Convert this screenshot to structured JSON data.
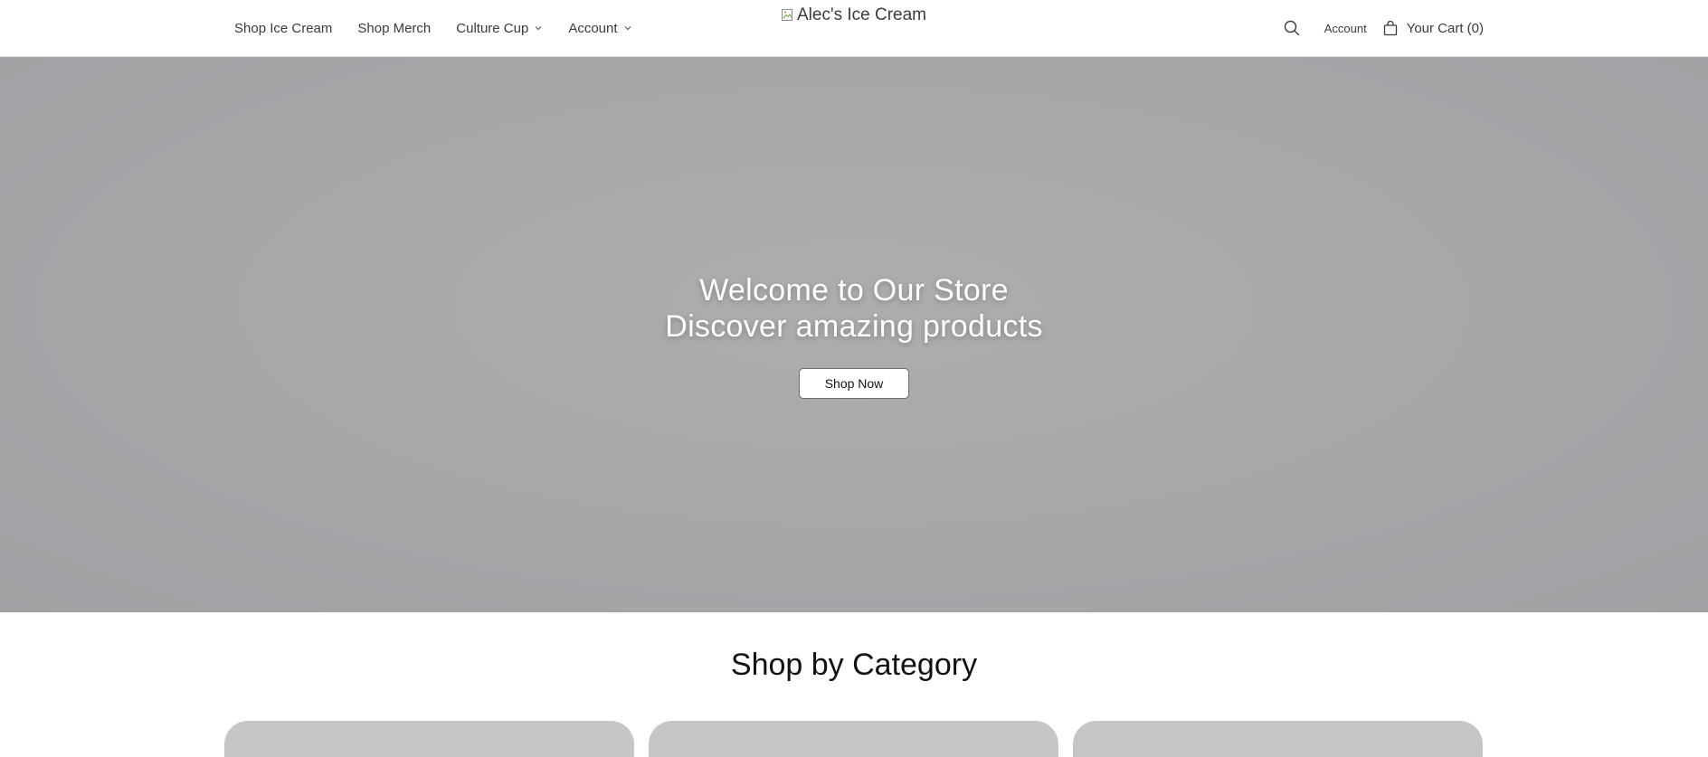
{
  "header": {
    "nav": [
      {
        "label": "Shop Ice Cream",
        "has_dropdown": false
      },
      {
        "label": "Shop Merch",
        "has_dropdown": false
      },
      {
        "label": "Culture Cup",
        "has_dropdown": true
      },
      {
        "label": "Account",
        "has_dropdown": true
      }
    ],
    "logo_alt": "Alec's Ice Cream",
    "account_label": "Account",
    "cart_label": "Your Cart (0)"
  },
  "hero": {
    "title_line1": "Welcome to Our Store",
    "title_line2": "Discover amazing products",
    "button_label": "Shop Now"
  },
  "category": {
    "title": "Shop by Category",
    "cards": 3
  },
  "icons": {
    "search": "search-icon",
    "cart": "shopping-bag-icon",
    "chevron": "chevron-down-icon",
    "broken_image": "broken-image-icon"
  },
  "colors": {
    "hero_bg": "#a6a7a9",
    "card_bg": "#c6c6c6",
    "text": "#3b3b3b"
  }
}
